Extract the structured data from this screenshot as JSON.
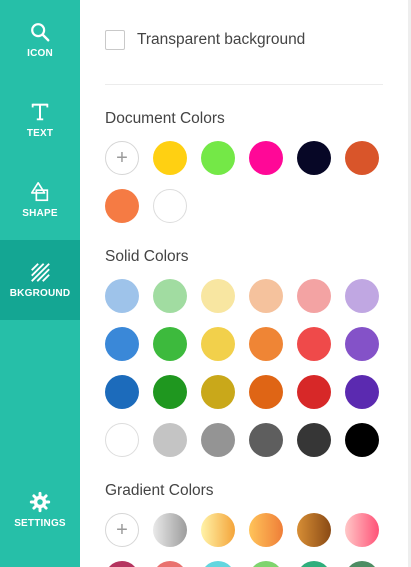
{
  "sidebar": {
    "items": [
      {
        "label": "ICON",
        "icon": "search-icon"
      },
      {
        "label": "TEXT",
        "icon": "text-icon"
      },
      {
        "label": "SHAPE",
        "icon": "shape-icon"
      },
      {
        "label": "BKGROUND",
        "icon": "background-icon",
        "active": true
      },
      {
        "label": "SETTINGS",
        "icon": "gear-icon"
      }
    ],
    "color": "#26bfa8",
    "active_color": "#14a693"
  },
  "panel": {
    "transparent_label": "Transparent background",
    "transparent_checked": false,
    "document_colors": {
      "title": "Document Colors",
      "add_symbol": "+",
      "colors": [
        "#ffd012",
        "#74e847",
        "#ff0897",
        "#070726",
        "#d9552a",
        "#f57b44",
        "#ffffff"
      ]
    },
    "solid_colors": {
      "title": "Solid Colors",
      "rows": [
        [
          "#9ec3ea",
          "#a1dca1",
          "#f8e6a1",
          "#f5c29d",
          "#f3a3a3",
          "#c0a7e2"
        ],
        [
          "#3a88d8",
          "#3dba3d",
          "#f2d04b",
          "#ef8535",
          "#ef4a4a",
          "#8452c8"
        ],
        [
          "#1c6bbb",
          "#1f971f",
          "#c9a81a",
          "#df6515",
          "#d72828",
          "#5b2ab0"
        ],
        [
          "#ffffff",
          "#c4c4c4",
          "#949494",
          "#5e5e5e",
          "#363636",
          "#000000"
        ]
      ]
    },
    "gradient_colors": {
      "title": "Gradient Colors",
      "add_symbol": "+",
      "gradients": [
        [
          "#e9e9e9",
          "#9c9c9c"
        ],
        [
          "#fff3a8",
          "#f4a43a"
        ],
        [
          "#ffc45a",
          "#ef7e38"
        ],
        [
          "#d78e35",
          "#8a4a15"
        ],
        [
          "#ffc7c7",
          "#ff5277"
        ]
      ],
      "partial_row": [
        "#b5345f",
        "#e9726f",
        "#63d6df",
        "#7fd46e",
        "#2fae7c",
        "#4d8c63"
      ]
    }
  }
}
